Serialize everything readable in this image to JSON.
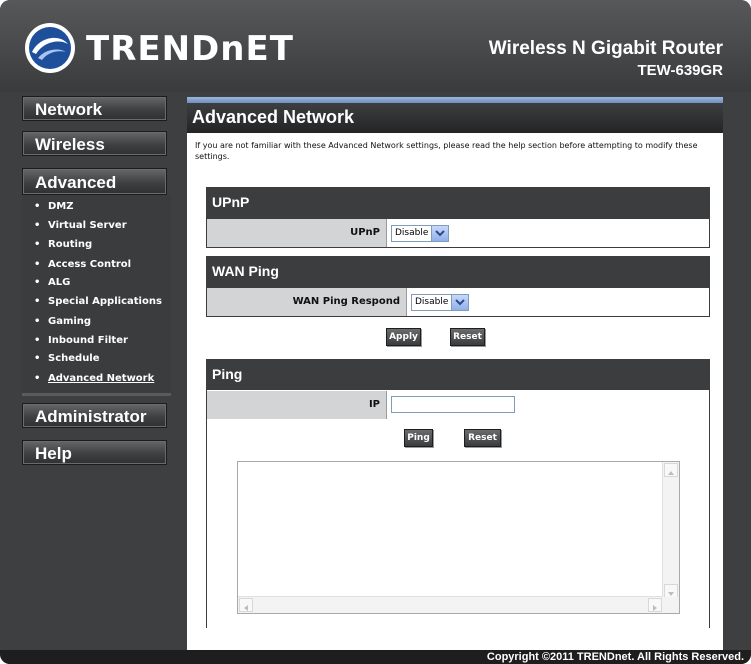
{
  "brand": {
    "logo_text": "TRENDnET",
    "product_title": "Wireless N Gigabit Router",
    "model": "TEW-639GR"
  },
  "nav": {
    "network": "Network",
    "wireless": "Wireless",
    "advanced": "Advanced",
    "administrator": "Administrator",
    "help": "Help",
    "advanced_items": [
      {
        "label": "DMZ"
      },
      {
        "label": "Virtual Server"
      },
      {
        "label": "Routing"
      },
      {
        "label": "Access Control"
      },
      {
        "label": "ALG"
      },
      {
        "label": "Special Applications"
      },
      {
        "label": "Gaming"
      },
      {
        "label": "Inbound Filter"
      },
      {
        "label": "Schedule"
      },
      {
        "label": "Advanced Network"
      }
    ],
    "bullet": "•"
  },
  "page": {
    "title": "Advanced Network",
    "notice": "If you are not familiar with these Advanced Network settings, please read the help section before attempting to modify these settings."
  },
  "upnp": {
    "section_title": "UPnP",
    "label": "UPnP",
    "value": "Disable"
  },
  "wan_ping": {
    "section_title": "WAN Ping",
    "label": "WAN Ping Respond",
    "value": "Disable"
  },
  "buttons": {
    "apply": "Apply",
    "reset": "Reset",
    "ping": "Ping"
  },
  "ping": {
    "section_title": "Ping",
    "ip_label": "IP",
    "ip_value": "",
    "output": ""
  },
  "footer": {
    "copyright": "Copyright ©2011 TRENDnet. All Rights Reserved."
  },
  "colors": {
    "frame": "#3e3f41",
    "section_header": "#3c3d3f",
    "label_cell": "#d3d4d6",
    "title_accent": "#7f9bc8"
  }
}
